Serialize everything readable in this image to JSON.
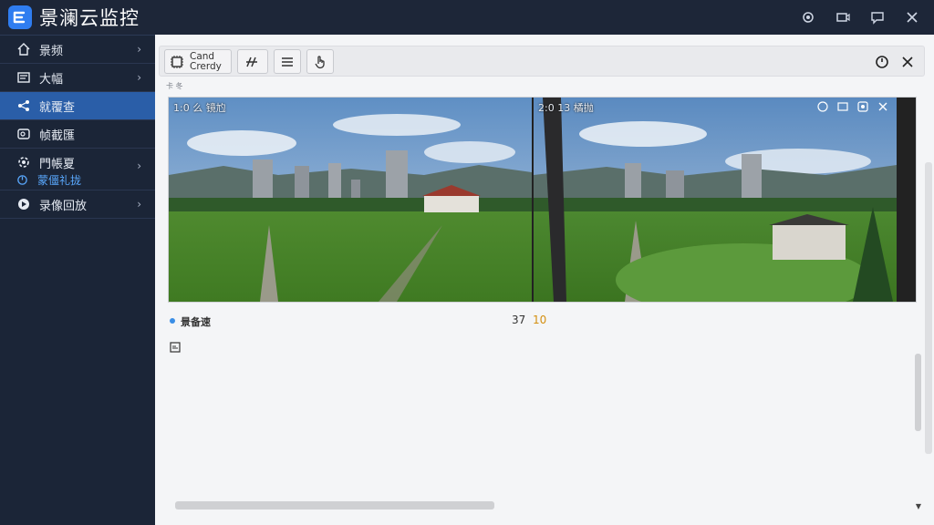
{
  "app": {
    "title": "景澜云监控"
  },
  "sidebar": {
    "items": [
      {
        "label": "景频",
        "icon": "home-icon",
        "has_chevron": true
      },
      {
        "label": "大幅",
        "icon": "list-icon",
        "has_chevron": true
      },
      {
        "label": "就覆查",
        "icon": "share-icon",
        "has_chevron": false,
        "active": true
      },
      {
        "label": "帧截匯",
        "icon": "image-icon",
        "has_chevron": false
      },
      {
        "label": "門帳夏",
        "icon": "settings-icon",
        "has_chevron": true,
        "sub_label": "蒙僵礼拢"
      },
      {
        "label": "录像回放",
        "icon": "playback-icon",
        "has_chevron": true
      }
    ]
  },
  "toolbar": {
    "card_line1": "Cand",
    "card_line2": "Crerdy"
  },
  "tiny_label": "卡 冬",
  "views": [
    {
      "title": "1:0  么 镜尥"
    },
    {
      "title": "2:0  13 橘抛"
    }
  ],
  "status": {
    "label": "景备速",
    "num_primary": "37",
    "num_secondary": "10"
  },
  "colors": {
    "sidebar_bg": "#1b2537",
    "active_item": "#2a5ea8",
    "accent_blue": "#3a8ee6",
    "accent_orange": "#d48f10"
  }
}
